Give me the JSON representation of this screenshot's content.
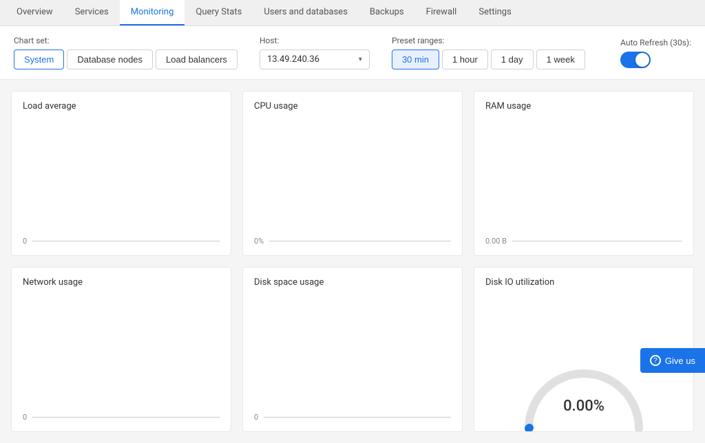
{
  "tabs": [
    {
      "id": "overview",
      "label": "Overview",
      "active": false
    },
    {
      "id": "services",
      "label": "Services",
      "active": false
    },
    {
      "id": "monitoring",
      "label": "Monitoring",
      "active": true
    },
    {
      "id": "query-stats",
      "label": "Query Stats",
      "active": false
    },
    {
      "id": "users-databases",
      "label": "Users and databases",
      "active": false
    },
    {
      "id": "backups",
      "label": "Backups",
      "active": false
    },
    {
      "id": "firewall",
      "label": "Firewall",
      "active": false
    },
    {
      "id": "settings",
      "label": "Settings",
      "active": false
    }
  ],
  "controls": {
    "chart_set_label": "Chart set:",
    "chart_set_buttons": [
      {
        "id": "system",
        "label": "System",
        "active": true
      },
      {
        "id": "database-nodes",
        "label": "Database nodes",
        "active": false
      },
      {
        "id": "load-balancers",
        "label": "Load balancers",
        "active": false
      }
    ],
    "host_label": "Host:",
    "host_value": "13.49.240.36",
    "preset_label": "Preset ranges:",
    "preset_buttons": [
      {
        "id": "30min",
        "label": "30 min",
        "active": true
      },
      {
        "id": "1hour",
        "label": "1 hour",
        "active": false
      },
      {
        "id": "1day",
        "label": "1 day",
        "active": false
      },
      {
        "id": "1week",
        "label": "1 week",
        "active": false
      }
    ],
    "auto_refresh_label": "Auto Refresh (30s):",
    "auto_refresh_on": true
  },
  "charts": [
    {
      "id": "load-average",
      "title": "Load average",
      "zero_label": "0"
    },
    {
      "id": "cpu-usage",
      "title": "CPU usage",
      "zero_label": "0%"
    },
    {
      "id": "ram-usage",
      "title": "RAM usage",
      "zero_label": "0.00 B"
    },
    {
      "id": "network-usage",
      "title": "Network usage",
      "zero_label": "0"
    },
    {
      "id": "disk-space",
      "title": "Disk space usage",
      "zero_label": "0"
    }
  ],
  "disk_io": {
    "title": "Disk IO utilization",
    "percent": "0.00%"
  },
  "feedback": {
    "label": "Give us"
  }
}
